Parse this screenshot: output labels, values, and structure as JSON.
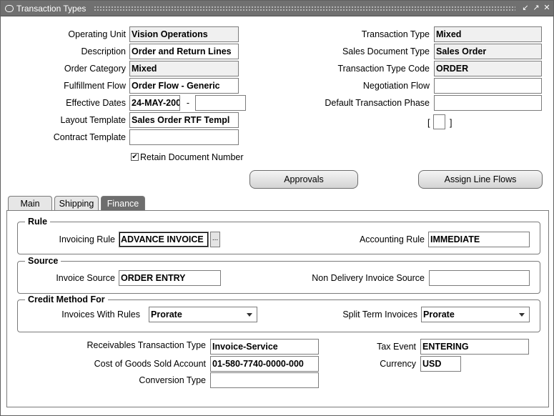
{
  "window": {
    "title": "Transaction Types"
  },
  "header": {
    "operating_unit": {
      "label": "Operating Unit",
      "value": "Vision Operations"
    },
    "description": {
      "label": "Description",
      "value": "Order and Return Lines"
    },
    "order_category": {
      "label": "Order Category",
      "value": "Mixed"
    },
    "fulfillment_flow": {
      "label": "Fulfillment Flow",
      "value": "Order Flow - Generic"
    },
    "effective_dates": {
      "label": "Effective Dates",
      "from": "24-MAY-200",
      "separator": "-",
      "to": ""
    },
    "layout_template": {
      "label": "Layout Template",
      "value": "Sales Order RTF Templ"
    },
    "contract_template": {
      "label": "Contract Template",
      "value": ""
    },
    "retain_doc_number": {
      "label": "Retain Document Number",
      "checked": true
    },
    "transaction_type": {
      "label": "Transaction Type",
      "value": "Mixed"
    },
    "sales_document_type": {
      "label": "Sales Document Type",
      "value": "Sales Order"
    },
    "transaction_type_code": {
      "label": "Transaction Type Code",
      "value": "ORDER"
    },
    "negotiation_flow": {
      "label": "Negotiation Flow",
      "value": ""
    },
    "default_transaction_phase": {
      "label": "Default Transaction Phase",
      "value": ""
    },
    "dff": {
      "open": "[",
      "close": "]"
    }
  },
  "buttons": {
    "approvals": "Approvals",
    "assign_line_flows": "Assign Line  Flows"
  },
  "tabs": [
    {
      "label": "Main",
      "active": false
    },
    {
      "label": "Shipping",
      "active": false
    },
    {
      "label": "Finance",
      "active": true
    }
  ],
  "finance": {
    "rule": {
      "title": "Rule",
      "invoicing_rule": {
        "label": "Invoicing Rule",
        "value": "ADVANCE INVOICE"
      },
      "accounting_rule": {
        "label": "Accounting Rule",
        "value": "IMMEDIATE"
      }
    },
    "source": {
      "title": "Source",
      "invoice_source": {
        "label": "Invoice Source",
        "value": "ORDER ENTRY"
      },
      "non_delivery_invoice_source": {
        "label": "Non Delivery Invoice Source",
        "value": ""
      }
    },
    "credit_method": {
      "title": "Credit Method For",
      "invoices_with_rules": {
        "label": "Invoices With Rules",
        "value": "Prorate"
      },
      "split_term_invoices": {
        "label": "Split Term Invoices",
        "value": "Prorate"
      }
    },
    "receivables_transaction_type": {
      "label": "Receivables Transaction Type",
      "value": "Invoice-Service"
    },
    "cogs_account": {
      "label": "Cost of Goods Sold Account",
      "value": "01-580-7740-0000-000"
    },
    "conversion_type": {
      "label": "Conversion Type",
      "value": ""
    },
    "tax_event": {
      "label": "Tax Event",
      "value": "ENTERING"
    },
    "currency": {
      "label": "Currency",
      "value": "USD"
    }
  },
  "icons": {
    "lov": "...",
    "check": "✔"
  }
}
